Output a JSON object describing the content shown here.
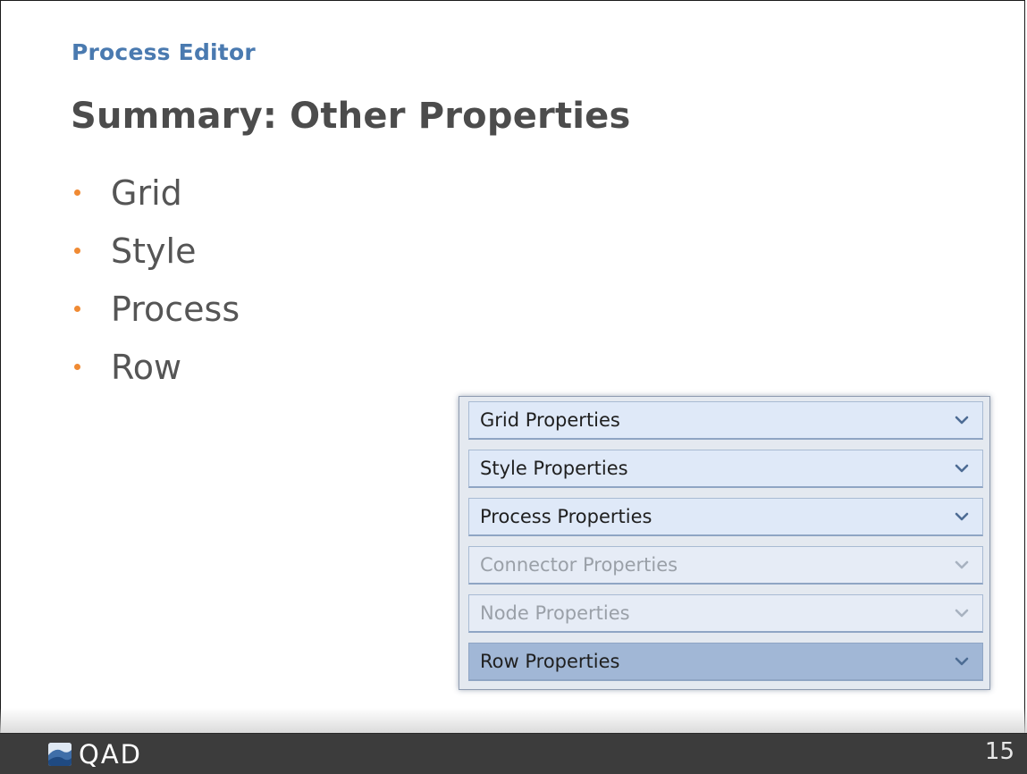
{
  "slide": {
    "section_label": "Process Editor",
    "title": "Summary: Other Properties",
    "bullets": [
      "Grid",
      "Style",
      "Process",
      "Row"
    ]
  },
  "panel": {
    "rows": [
      {
        "label": "Grid Properties",
        "state": "enabled",
        "icon": "chevron-down-icon"
      },
      {
        "label": "Style Properties",
        "state": "enabled",
        "icon": "chevron-down-icon"
      },
      {
        "label": "Process Properties",
        "state": "enabled",
        "icon": "chevron-down-icon"
      },
      {
        "label": "Connector Properties",
        "state": "disabled",
        "icon": "chevron-down-icon"
      },
      {
        "label": "Node Properties",
        "state": "disabled",
        "icon": "chevron-down-icon"
      },
      {
        "label": "Row Properties",
        "state": "selected",
        "icon": "chevron-down-icon"
      }
    ]
  },
  "footer": {
    "logo_text": "QAD",
    "page_number": "15"
  },
  "colors": {
    "section_label": "#4a7ab0",
    "title": "#4c4c4c",
    "bullet_dot": "#f08a33",
    "footer_bg": "#3c3c3c",
    "row_bg": "#dfe9f8",
    "row_selected_bg": "#a1b7d6"
  }
}
